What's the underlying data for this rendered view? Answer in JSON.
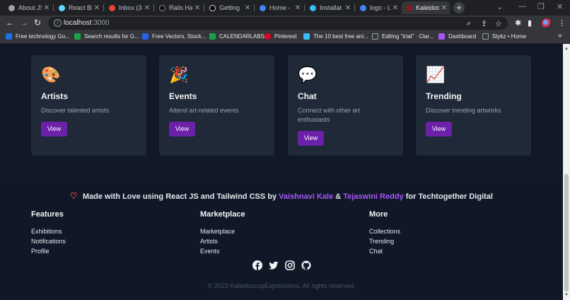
{
  "browser": {
    "tabs": [
      {
        "title": "About JS",
        "fav": "#a1a1aa"
      },
      {
        "title": "React Bl",
        "fav": "#61dafb"
      },
      {
        "title": "Inbox (3",
        "fav": "#ea4335"
      },
      {
        "title": "Rails Ha",
        "fav": "#222"
      },
      {
        "title": "Getting",
        "fav": "#000"
      },
      {
        "title": "Home -",
        "fav": "#4285f4"
      },
      {
        "title": "Installat",
        "fav": "#38bdf8"
      },
      {
        "title": "logo - L",
        "fav": "#4285f4"
      },
      {
        "title": "Kaleidos",
        "fav": "#7f1d1d"
      }
    ],
    "new_tab": "+",
    "url_host": "localhost",
    "url_port": ":3000",
    "bookmarks": [
      {
        "label": "Free technology Go...",
        "color": "#1a73e8"
      },
      {
        "label": "Search results for G...",
        "color": "#16a34a"
      },
      {
        "label": "Free Vectors, Stock...",
        "color": "#2563eb"
      },
      {
        "label": "CALENDARLABS",
        "color": "#16a34a"
      },
      {
        "label": "Pinterest",
        "color": "#e60023"
      },
      {
        "label": "The 10 best free ani...",
        "color": "#38bdf8"
      },
      {
        "label": "Editing \"trial\" · Clar...",
        "color": "#9aa0a6"
      },
      {
        "label": "Dashboard",
        "color": "#a855f7"
      },
      {
        "label": "Stykz • Home",
        "color": "#9aa0a6"
      }
    ],
    "more_bookmarks": "»"
  },
  "cards": [
    {
      "title": "Artists",
      "desc": "Discover talented artists",
      "button": "View",
      "icon": "🎨"
    },
    {
      "title": "Events",
      "desc": "Attend art-related events",
      "button": "View",
      "icon": "🎉"
    },
    {
      "title": "Chat",
      "desc": "Connect with other art enthusiasts",
      "button": "View",
      "icon": "💬"
    },
    {
      "title": "Trending",
      "desc": "Discover trending artworks",
      "button": "View",
      "icon": "📈"
    }
  ],
  "footer": {
    "love_prefix": "Made with Love using React JS and Tailwind CSS by",
    "author1": "Vaishnavi Kale",
    "amp": "&",
    "author2": "Tejaswini Reddy",
    "love_suffix": "for Techtogether Digital",
    "columns": [
      {
        "heading": "Features",
        "links": [
          "Exhibitions",
          "Notifications",
          "Profile"
        ]
      },
      {
        "heading": "Marketplace",
        "links": [
          "Marketplace",
          "Artists",
          "Events"
        ]
      },
      {
        "heading": "More",
        "links": [
          "Collections",
          "Trending",
          "Chat"
        ]
      }
    ],
    "copyright": "© 2023 KaleidoscopExpressions. All rights reserved."
  }
}
